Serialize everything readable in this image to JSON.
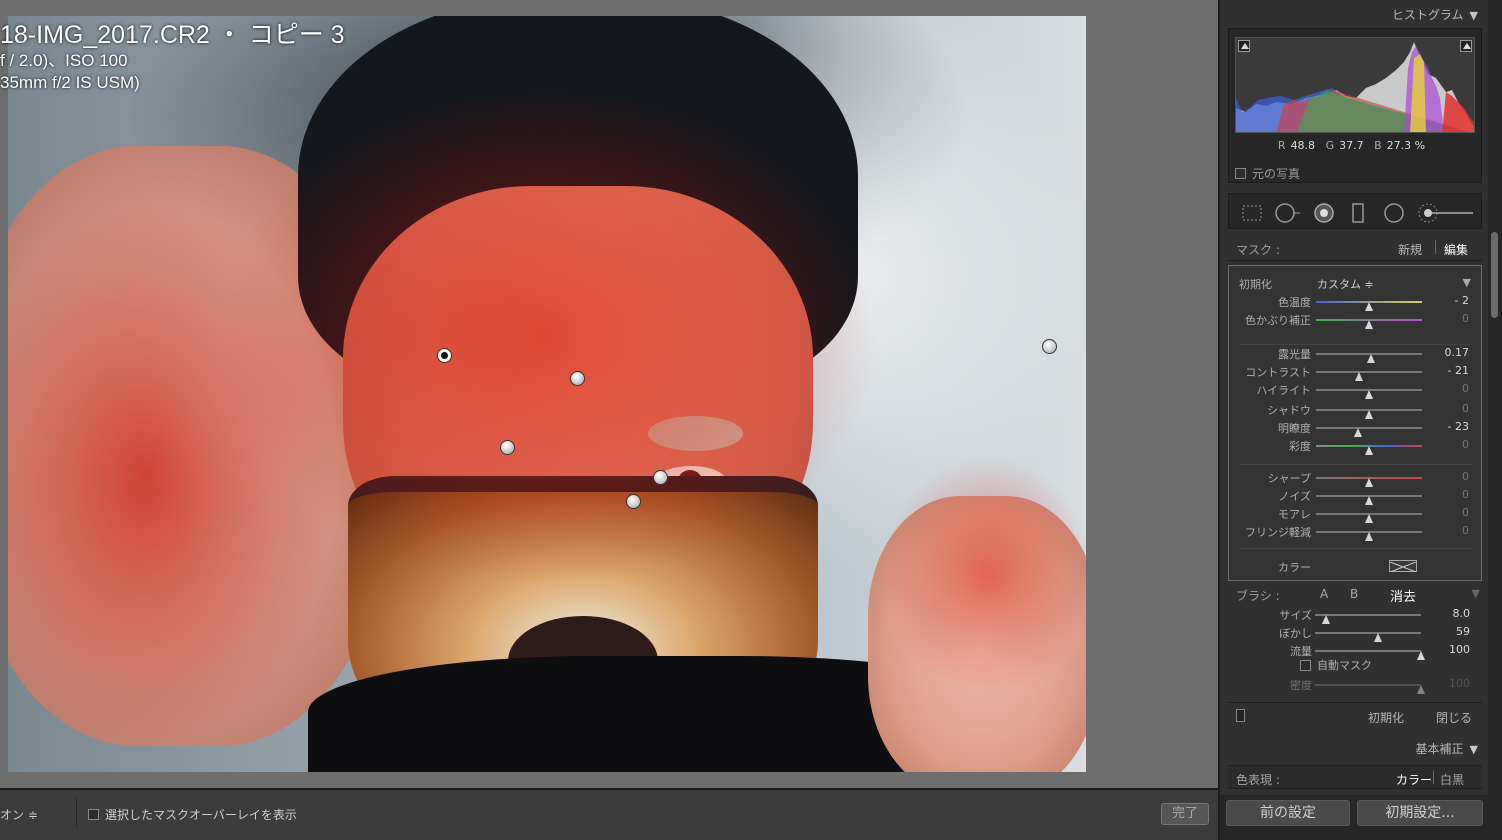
{
  "photo": {
    "filename_line": "18-IMG_2017.CR2 ・ コピー 3",
    "exposure_line": "f / 2.0)、ISO 100",
    "lens_line": "35mm f/2 IS USM)"
  },
  "toolbar": {
    "pin_mode_label": "オン ≑",
    "overlay_checkbox_label": "選択したマスクオーバーレイを表示",
    "done_label": "完了"
  },
  "panel": {
    "histogram": {
      "title": "ヒストグラム",
      "r_label": "R",
      "r_value": "48.8",
      "g_label": "G",
      "g_value": "37.7",
      "b_label": "B",
      "b_value": "27.3 %",
      "original_photo_label": "元の写真"
    },
    "mask": {
      "label": "マスク :",
      "new_label": "新規",
      "edit_label": "編集"
    },
    "effect": {
      "reset_label": "初期化",
      "preset_value": "カスタム ≑"
    },
    "sliders": [
      {
        "name": "色温度",
        "value": "- 2",
        "position": 0.5
      },
      {
        "name": "色かぶり補正",
        "value": "0",
        "position": 0.5
      },
      {
        "name": "露光量",
        "value": "0.17",
        "position": 0.52
      },
      {
        "name": "コントラスト",
        "value": "- 21",
        "position": 0.41
      },
      {
        "name": "ハイライト",
        "value": "0",
        "position": 0.5
      },
      {
        "name": "シャドウ",
        "value": "0",
        "position": 0.5
      },
      {
        "name": "明瞭度",
        "value": "- 23",
        "position": 0.4
      },
      {
        "name": "彩度",
        "value": "0",
        "position": 0.5
      },
      {
        "name": "シャープ",
        "value": "0",
        "position": 0.5
      },
      {
        "name": "ノイズ",
        "value": "0",
        "position": 0.5
      },
      {
        "name": "モアレ",
        "value": "0",
        "position": 0.5
      },
      {
        "name": "フリンジ軽減",
        "value": "0",
        "position": 0.5
      }
    ],
    "color_label": "カラー",
    "brush": {
      "label": "ブラシ :",
      "a_label": "A",
      "b_label": "B",
      "erase_label": "消去",
      "size_label": "サイズ",
      "size_value": "8.0",
      "size_position": 0.1,
      "feather_label": "ぼかし",
      "feather_value": "59",
      "feather_position": 0.59,
      "flow_label": "流量",
      "flow_value": "100",
      "flow_position": 1.0,
      "auto_mask_label": "自動マスク",
      "density_label": "密度",
      "density_value": "100",
      "density_position": 1.0
    },
    "footer": {
      "reset_label": "初期化",
      "close_label": "閉じる"
    },
    "basic": {
      "title": "基本補正",
      "treatment_label": "色表現 :",
      "color_option": "カラー",
      "bw_option": "白黒"
    },
    "buttons": {
      "previous_label": "前の設定",
      "reset_label": "初期設定..."
    }
  }
}
